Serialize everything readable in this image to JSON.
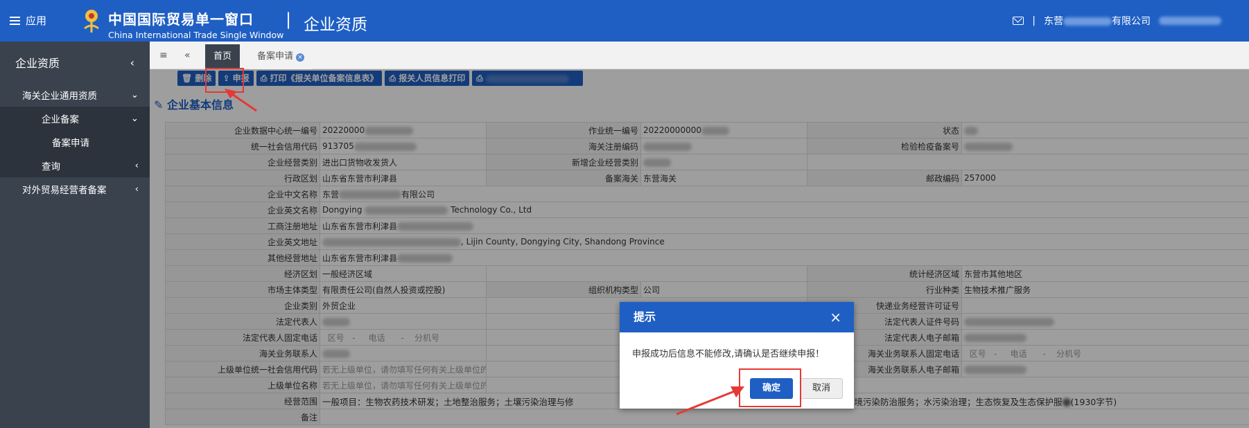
{
  "header": {
    "menu_label": "应用",
    "brand_cn": "中国国际贸易单一窗口",
    "brand_en": "China International Trade Single Window",
    "separator": "|",
    "module_title": "企业资质",
    "company_prefix": "东营",
    "company_suffix": "有限公司"
  },
  "sidebar": {
    "title": "企业资质",
    "items": [
      {
        "label": "海关企业通用资质"
      },
      {
        "label": "企业备案"
      },
      {
        "label": "备案申请"
      },
      {
        "label": "查询"
      },
      {
        "label": "对外贸易经营者备案"
      }
    ]
  },
  "tabs": [
    {
      "label": "首页"
    },
    {
      "label": "备案申请"
    }
  ],
  "toolbar": {
    "delete": "删除",
    "submit": "申报",
    "print_info": "打印《报关单位备案信息表》",
    "print_staff": "报关人员信息打印"
  },
  "section_title": "企业基本信息",
  "form": {
    "labels": {
      "l1": "企业数据中心统一编号",
      "l2": "作业统一编号",
      "l3": "状态",
      "l4": "统一社会信用代码",
      "l5": "海关注册编码",
      "l6": "检验检疫备案号",
      "l7": "企业经营类别",
      "l8": "新增企业经营类别",
      "l9": "行政区划",
      "l10": "备案海关",
      "l11": "邮政编码",
      "l12": "企业中文名称",
      "l13": "企业英文名称",
      "l14": "工商注册地址",
      "l15": "企业英文地址",
      "l16": "其他经营地址",
      "l17": "经济区划",
      "l18": "统计经济区域",
      "l19": "市场主体类型",
      "l20": "组织机构类型",
      "l21": "行业种类",
      "l22": "企业类别",
      "l23": "快递业务经营许可证号",
      "l24": "法定代表人",
      "l25": "法定代表人证件号码",
      "l26": "法定代表人固定电话",
      "l27": "法定代表人电子邮箱",
      "l28": "海关业务联系人",
      "l29": "海关业务联系人固定电话",
      "l30": "上级单位统一社会信用代码",
      "l31": "海关业务联系人电子邮箱",
      "l32": "上级单位名称",
      "l33": "经营范围",
      "l34": "备注"
    },
    "values": {
      "v1": "20220000",
      "v2": "20220000000",
      "v4": "913705",
      "v7": "进出口货物收发货人",
      "v9": "山东省东营市利津县",
      "v10": "东营海关",
      "v11": "257000",
      "v12_pre": "东营",
      "v12_suf": "有限公司",
      "v13_pre": "Dongying",
      "v13_suf": "Technology Co., Ltd",
      "v14": "山东省东营市利津县",
      "v15": ", Lijin County, Dongying City, Shandong Province",
      "v16": "山东省东营市利津县",
      "v17": "一般经济区域",
      "v18": "东营市其他地区",
      "v19": "有限责任公司(自然人投资或控股)",
      "v20": "公司",
      "v21": "生物技术推广服务",
      "v22": "外贸企业",
      "phone_area": "区号",
      "phone_dash": "-",
      "phone_num": "电话",
      "phone_ext": "分机号",
      "v30": "若无上级单位，请勿填写任何有关上级单位的信息",
      "v32": "若无上级单位，请勿填写任何有关上级单位的信息",
      "v33_pre": "一般项目：生物农药技术研发；土地整治服务；土壤污染治理与修",
      "v33_suf": "水环境污染防治服务；水污染治理；生态恢复及生态保护服",
      "v33_count": "(1930字节)"
    }
  },
  "dialog": {
    "title": "提示",
    "close": "×",
    "message": "申报成功后信息不能修改,请确认是否继续申报！",
    "ok": "确定",
    "cancel": "取消"
  }
}
